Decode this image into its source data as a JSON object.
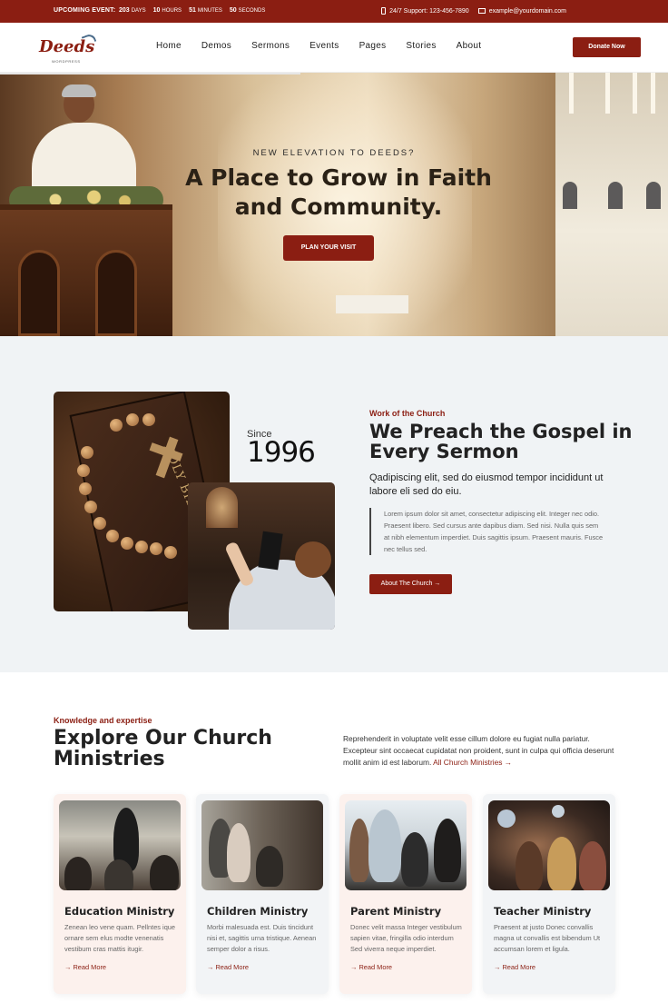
{
  "topbar": {
    "event_label": "UPCOMING EVENT:",
    "countdown": [
      {
        "value": "203",
        "unit": "DAYS"
      },
      {
        "value": "10",
        "unit": "HOURS"
      },
      {
        "value": "51",
        "unit": "MINUTES"
      },
      {
        "value": "50",
        "unit": "SECONDS"
      }
    ],
    "support": "24/7 Support: 123-456-7890",
    "email": "example@yourdomain.com"
  },
  "nav": {
    "logo_text": "Deeds",
    "logo_sub": "WORDPRESS",
    "menu": [
      "Home",
      "Demos",
      "Sermons",
      "Events",
      "Pages",
      "Stories",
      "About"
    ],
    "donate_label": "Donate Now"
  },
  "hero": {
    "eyebrow": "NEW ELEVATION TO DEEDS?",
    "title_line1": "A Place to Grow in Faith",
    "title_line2": "and Community.",
    "cta_label": "PLAN YOUR VISIT",
    "slide_progress": 0.45
  },
  "about": {
    "since_label": "Since",
    "since_year": "1996",
    "eyebrow": "Work of the Church",
    "title": "We Preach the Gospel in Every Sermon",
    "lead": "Qadipiscing elit, sed do eiusmod tempor incididunt ut labore eli sed do eiu.",
    "quote": "Lorem ipsum dolor sit amet, consectetur adipiscing elit. Integer nec odio. Praesent libero. Sed cursus ante dapibus diam. Sed nisi. Nulla quis sem at nibh elementum imperdiet. Duis sagittis ipsum. Praesent mauris. Fusce nec tellus sed.",
    "button_label": "About The Church →"
  },
  "ministries": {
    "eyebrow": "Knowledge and expertise",
    "title": "Explore Our Church Ministries",
    "text": "Reprehenderit in voluptate velit esse cillum dolore eu fugiat nulla pariatur. Excepteur sint occaecat cupidatat non proident, sunt in culpa qui officia deserunt mollit anim id est laborum.",
    "link_label": "All Church Ministries →",
    "cards": [
      {
        "name": "Education Ministry",
        "desc": "Zenean leo vene quam. Pellntes ique ornare sem elus modte venenatis vestibum cras mattis itugir.",
        "more": "Read More"
      },
      {
        "name": "Children Ministry",
        "desc": "Morbi malesuada est. Duis tincidunt nisi et, sagittis urna tristique. Aenean semper dolor a risus.",
        "more": "Read More"
      },
      {
        "name": "Parent Ministry",
        "desc": "Donec velit massa Integer vestibulum sapien vitae, fringilla odio interdum Sed viverra neque imperdiet.",
        "more": "Read More"
      },
      {
        "name": "Teacher Ministry",
        "desc": "Praesent at justo Donec convallis magna ut convallis est bibendum Ut accumsan lorem et ligula.",
        "more": "Read More"
      }
    ]
  },
  "colors": {
    "accent": "#8b1e12",
    "section_bg": "#f0f3f5"
  }
}
